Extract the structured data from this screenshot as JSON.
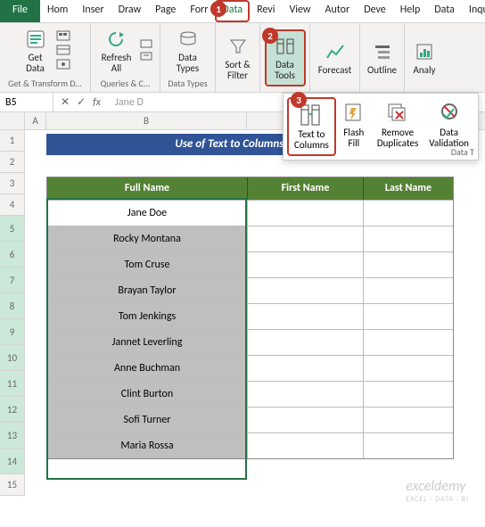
{
  "tabs": [
    "File",
    "Hom",
    "Inser",
    "Draw",
    "Page",
    "Forr",
    "Data",
    "Revi",
    "View",
    "Autor",
    "Deve",
    "Help",
    "Data",
    "Inqui"
  ],
  "active_tab_index": 6,
  "badges": {
    "b1": "1",
    "b2": "2",
    "b3": "3"
  },
  "ribbon": {
    "getdata": {
      "label": "Get\nData",
      "group": "Get & Transform D..."
    },
    "refresh": {
      "label": "Refresh\nAll",
      "group": "Queries & C..."
    },
    "datatypes": {
      "label": "Data\nTypes",
      "group": "Data Types"
    },
    "sortfilter": {
      "label": "Sort &\nFilter"
    },
    "datatools": {
      "label": "Data\nTools"
    },
    "forecast": {
      "label": "Forecast"
    },
    "outline": {
      "label": "Outline"
    },
    "analyze": {
      "label": "Analy"
    }
  },
  "dropdown": {
    "t2c": "Text to\nColumns",
    "flash": "Flash\nFill",
    "remove": "Remove\nDuplicates",
    "valid": "Data\nValidation",
    "group": "Data T"
  },
  "namebox": "B5",
  "formula": "Jane D",
  "colheads": {
    "A": "A",
    "B": "B"
  },
  "rownums": [
    "1",
    "2",
    "3",
    "4",
    "5",
    "6",
    "7",
    "8",
    "9",
    "10",
    "11",
    "12",
    "13",
    "14",
    "15"
  ],
  "title": "Use of Text to Columns Feature",
  "headers": {
    "c1": "Full Name",
    "c2": "First Name",
    "c3": "Last Name"
  },
  "names": [
    "Jane Doe",
    "Rocky Montana",
    "Tom Cruse",
    "Brayan Taylor",
    "Tom Jenkings",
    "Jannet Leverling",
    "Anne Buchman",
    "Clint Burton",
    "Sofi Turner",
    "Maria Rossa"
  ],
  "watermark": {
    "main": "exceldemy",
    "sub": "EXCEL · DATA · BI"
  }
}
